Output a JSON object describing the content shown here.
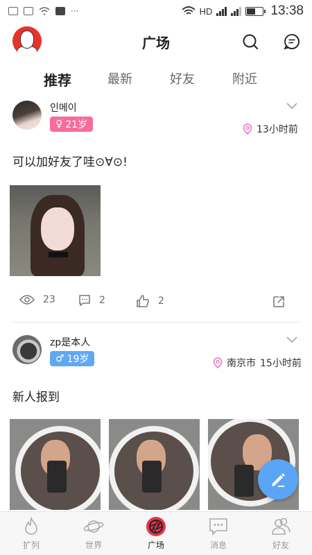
{
  "status_bar": {
    "network": "HD",
    "time": "13:38",
    "battery_level": 0.5
  },
  "header": {
    "title": "广场"
  },
  "tabs": [
    {
      "label": "推荐",
      "active": true
    },
    {
      "label": "最新",
      "active": false
    },
    {
      "label": "好友",
      "active": false
    },
    {
      "label": "附近",
      "active": false
    }
  ],
  "posts": [
    {
      "username": "인메이",
      "gender_symbol": "♀",
      "age": "21岁",
      "location": "",
      "time": "13小时前",
      "text": "可以加好友了哇⊙∀⊙!",
      "views": "23",
      "comments": "2",
      "likes": "2"
    },
    {
      "username": "zp是本人",
      "gender_symbol": "♂",
      "age": "19岁",
      "location": "南京市",
      "time": "15小时前",
      "text": "新人报到"
    }
  ],
  "bottom_nav": [
    {
      "label": "扩列",
      "icon": "fire-icon",
      "active": false
    },
    {
      "label": "世界",
      "icon": "planet-icon",
      "active": false
    },
    {
      "label": "广场",
      "icon": "aperture-icon",
      "active": true
    },
    {
      "label": "消息",
      "icon": "chat-bubble-icon",
      "active": false
    },
    {
      "label": "好友",
      "icon": "friends-icon",
      "active": false
    }
  ],
  "colors": {
    "female_badge": "#f76c9a",
    "male_badge": "#60a8f5",
    "fab": "#5aa5f5",
    "active_nav": "#e8334a",
    "location_pin": "#e87ac0"
  }
}
